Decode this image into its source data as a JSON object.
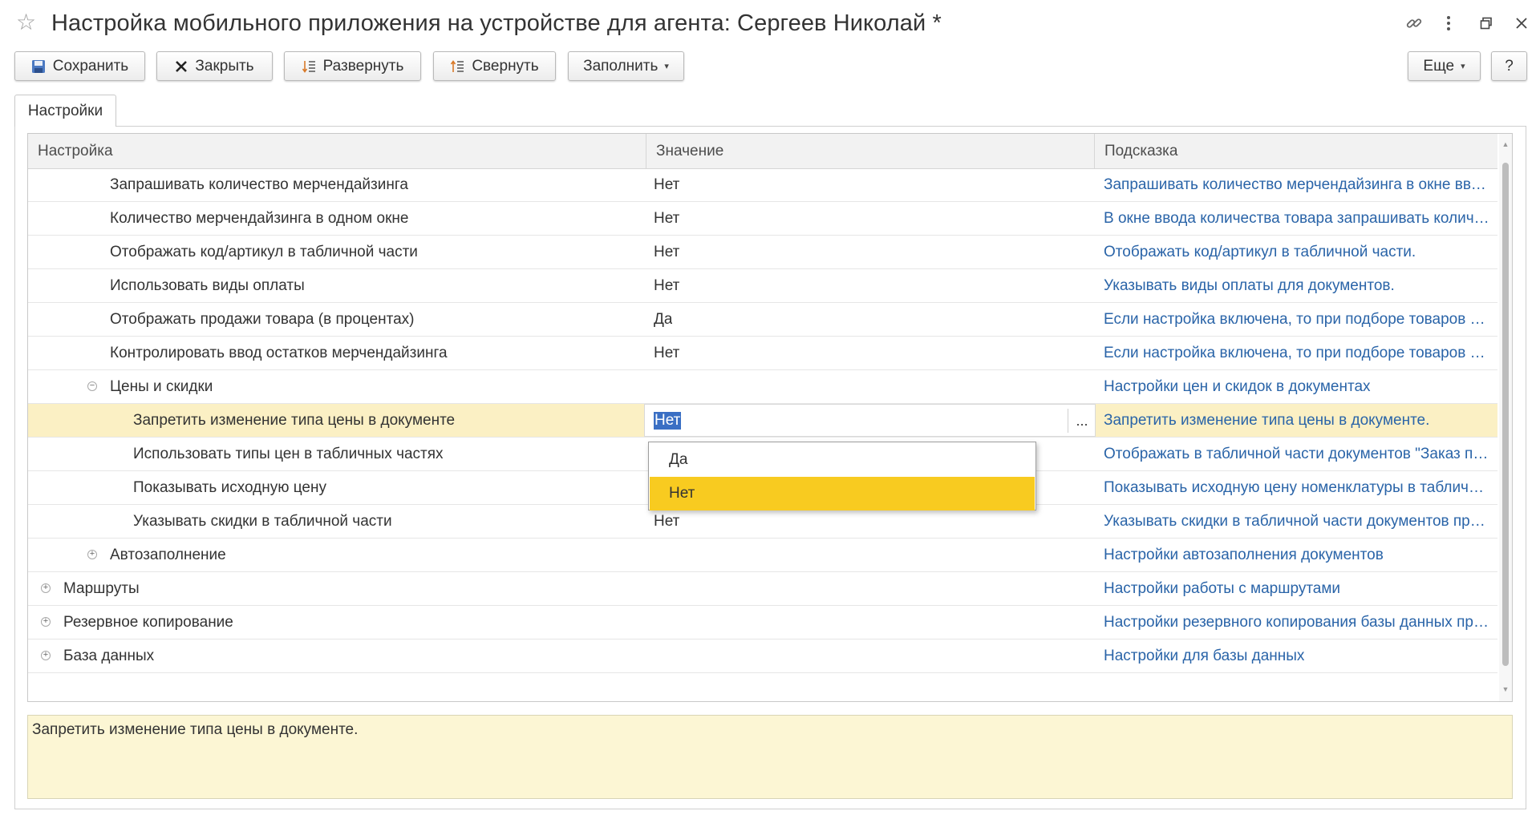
{
  "window": {
    "title": "Настройка мобильного приложения на устройстве для агента: Сергеев Николай *"
  },
  "toolbar": {
    "save_label": "Сохранить",
    "close_label": "Закрыть",
    "expand_label": "Развернуть",
    "collapse_label": "Свернуть",
    "fill_label": "Заполнить",
    "more_label": "Еще",
    "help_label": "?"
  },
  "tabs": [
    {
      "label": "Настройки",
      "active": true
    }
  ],
  "grid": {
    "columns": [
      "Настройка",
      "Значение",
      "Подсказка"
    ],
    "rows": [
      {
        "name": "Запрашивать количество мерчендайзинга",
        "value": "Нет",
        "hint": "Запрашивать количество мерчендайзинга в окне ввода количества товара",
        "level": 2
      },
      {
        "name": "Количество мерчендайзинга в одном окне",
        "value": "Нет",
        "hint": "В окне ввода количества товара запрашивать количество мерчендайзинга",
        "level": 2
      },
      {
        "name": "Отображать код/артикул в табличной части",
        "value": "Нет",
        "hint": "Отображать код/артикул в табличной части.",
        "level": 2
      },
      {
        "name": "Использовать виды оплаты",
        "value": "Нет",
        "hint": "Указывать виды оплаты для документов.",
        "level": 2
      },
      {
        "name": "Отображать продажи товара (в процентах)",
        "value": "Да",
        "hint": "Если настройка включена, то при подборе товаров отображаются продажи",
        "level": 2
      },
      {
        "name": "Контролировать ввод остатков мерчендайзинга",
        "value": "Нет",
        "hint": "Если настройка включена, то при подборе товаров контролируется ввод",
        "level": 2
      },
      {
        "name": "Цены и скидки",
        "value": "",
        "hint": "Настройки цен и скидок в документах",
        "level": 1,
        "group": "expanded"
      },
      {
        "name": "Запретить изменение типа цены в документе",
        "value": "Нет",
        "hint": "Запретить изменение типа цены в документе.",
        "level": 3,
        "selected": true
      },
      {
        "name": "Использовать типы цен в табличных частях",
        "value": "",
        "hint": "Отображать в табличной части документов \"Заказ покупателя\"",
        "level": 3
      },
      {
        "name": "Показывать исходную цену",
        "value": "",
        "hint": "Показывать исходную цену номенклатуры в табличной части",
        "level": 3
      },
      {
        "name": "Указывать скидки в табличной части",
        "value": "Нет",
        "hint": "Указывать скидки в табличной части документов продажи",
        "level": 3
      },
      {
        "name": "Автозаполнение",
        "value": "",
        "hint": "Настройки автозаполнения документов",
        "level": 1,
        "group": "collapsed"
      },
      {
        "name": "Маршруты",
        "value": "",
        "hint": "Настройки работы с маршрутами",
        "level": 0,
        "group": "collapsed"
      },
      {
        "name": "Резервное копирование",
        "value": "",
        "hint": "Настройки резервного копирования базы данных приложения",
        "level": 0,
        "group": "collapsed"
      },
      {
        "name": "База данных",
        "value": "",
        "hint": "Настройки для базы данных",
        "level": 0,
        "group": "collapsed"
      }
    ]
  },
  "dropdown": {
    "options": [
      "Да",
      "Нет"
    ],
    "active": "Нет",
    "ellipsis": "..."
  },
  "hint_panel": {
    "text": "Запретить изменение типа цены в документе."
  }
}
